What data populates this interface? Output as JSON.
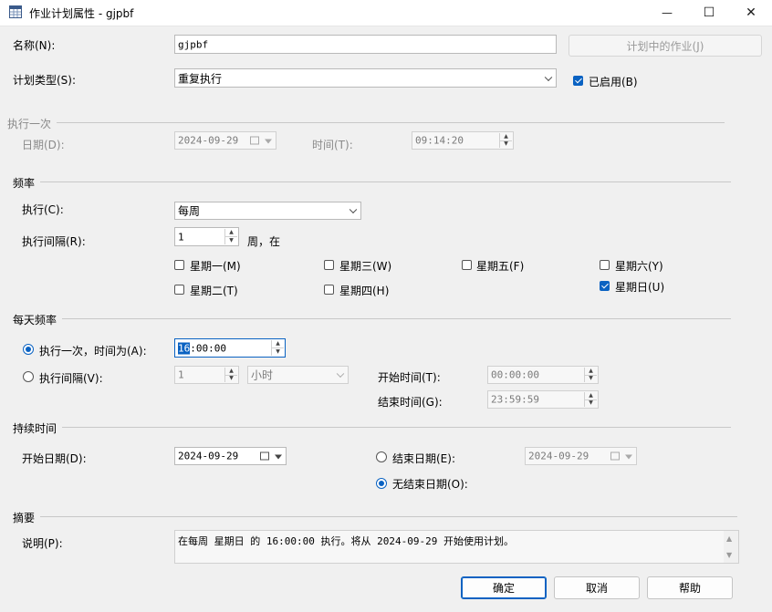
{
  "window": {
    "title": "作业计划属性 - gjpbf",
    "minimize": "—",
    "maximize": "☐",
    "close": "✕"
  },
  "name": {
    "label": "名称(N):",
    "value": "gjpbf"
  },
  "jobs_in_schedule": {
    "label": "计划中的作业(J)"
  },
  "schedule_type": {
    "label": "计划类型(S):",
    "value": "重复执行"
  },
  "enabled": {
    "label": "已启用(B)",
    "checked": true
  },
  "one_time": {
    "section": "执行一次",
    "date_label": "日期(D):",
    "date_value": "2024-09-29",
    "time_label": "时间(T):",
    "time_value": "09:14:20"
  },
  "frequency": {
    "section": "频率",
    "occurs_label": "执行(C):",
    "occurs_value": "每周",
    "recurs_label": "执行间隔(R):",
    "recurs_value": "1",
    "recurs_suffix": "周，在",
    "days": {
      "mon": {
        "label": "星期一(M)",
        "checked": false
      },
      "tue": {
        "label": "星期二(T)",
        "checked": false
      },
      "wed": {
        "label": "星期三(W)",
        "checked": false
      },
      "thu": {
        "label": "星期四(H)",
        "checked": false
      },
      "fri": {
        "label": "星期五(F)",
        "checked": false
      },
      "sat": {
        "label": "星期六(Y)",
        "checked": false
      },
      "sun": {
        "label": "星期日(U)",
        "checked": true
      }
    }
  },
  "daily": {
    "section": "每天频率",
    "once_label": "执行一次，时间为(A):",
    "once_sel": "16",
    "once_rest": ":00:00",
    "every_label": "执行间隔(V):",
    "every_value": "1",
    "every_unit": "小时",
    "start_label": "开始时间(T):",
    "start_value": "00:00:00",
    "end_label": "结束时间(G):",
    "end_value": "23:59:59"
  },
  "duration": {
    "section": "持续时间",
    "start_label": "开始日期(D):",
    "start_value": "2024-09-29",
    "end_label": "结束日期(E):",
    "end_value": "2024-09-29",
    "noend_label": "无结束日期(O):"
  },
  "summary": {
    "section": "摘要",
    "desc_label": "说明(P):",
    "desc_value": "在每周 星期日 的 16:00:00 执行。将从 2024-09-29 开始使用计划。"
  },
  "buttons": {
    "ok": "确定",
    "cancel": "取消",
    "help": "帮助"
  },
  "colors": {
    "accent": "#0a62c2"
  }
}
